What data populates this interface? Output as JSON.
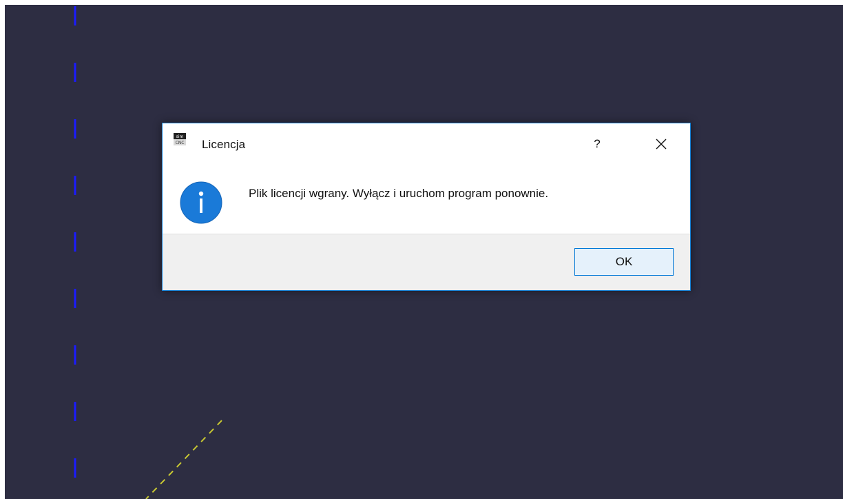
{
  "dialog": {
    "title": "Licencja",
    "help_label": "?",
    "message": "Plik licencji wgrany. Wyłącz i uruchom program ponownie.",
    "ok_label": "OK"
  },
  "app_icon": {
    "top_text": "sim",
    "bottom_text": "CNC"
  },
  "colors": {
    "canvas_background": "#2d2d42",
    "axis_line": "#1a1aff",
    "path_line": "#c8c832",
    "dialog_border": "#1883d7",
    "info_icon": "#1a7ad8",
    "ok_button_border": "#0078d7"
  }
}
